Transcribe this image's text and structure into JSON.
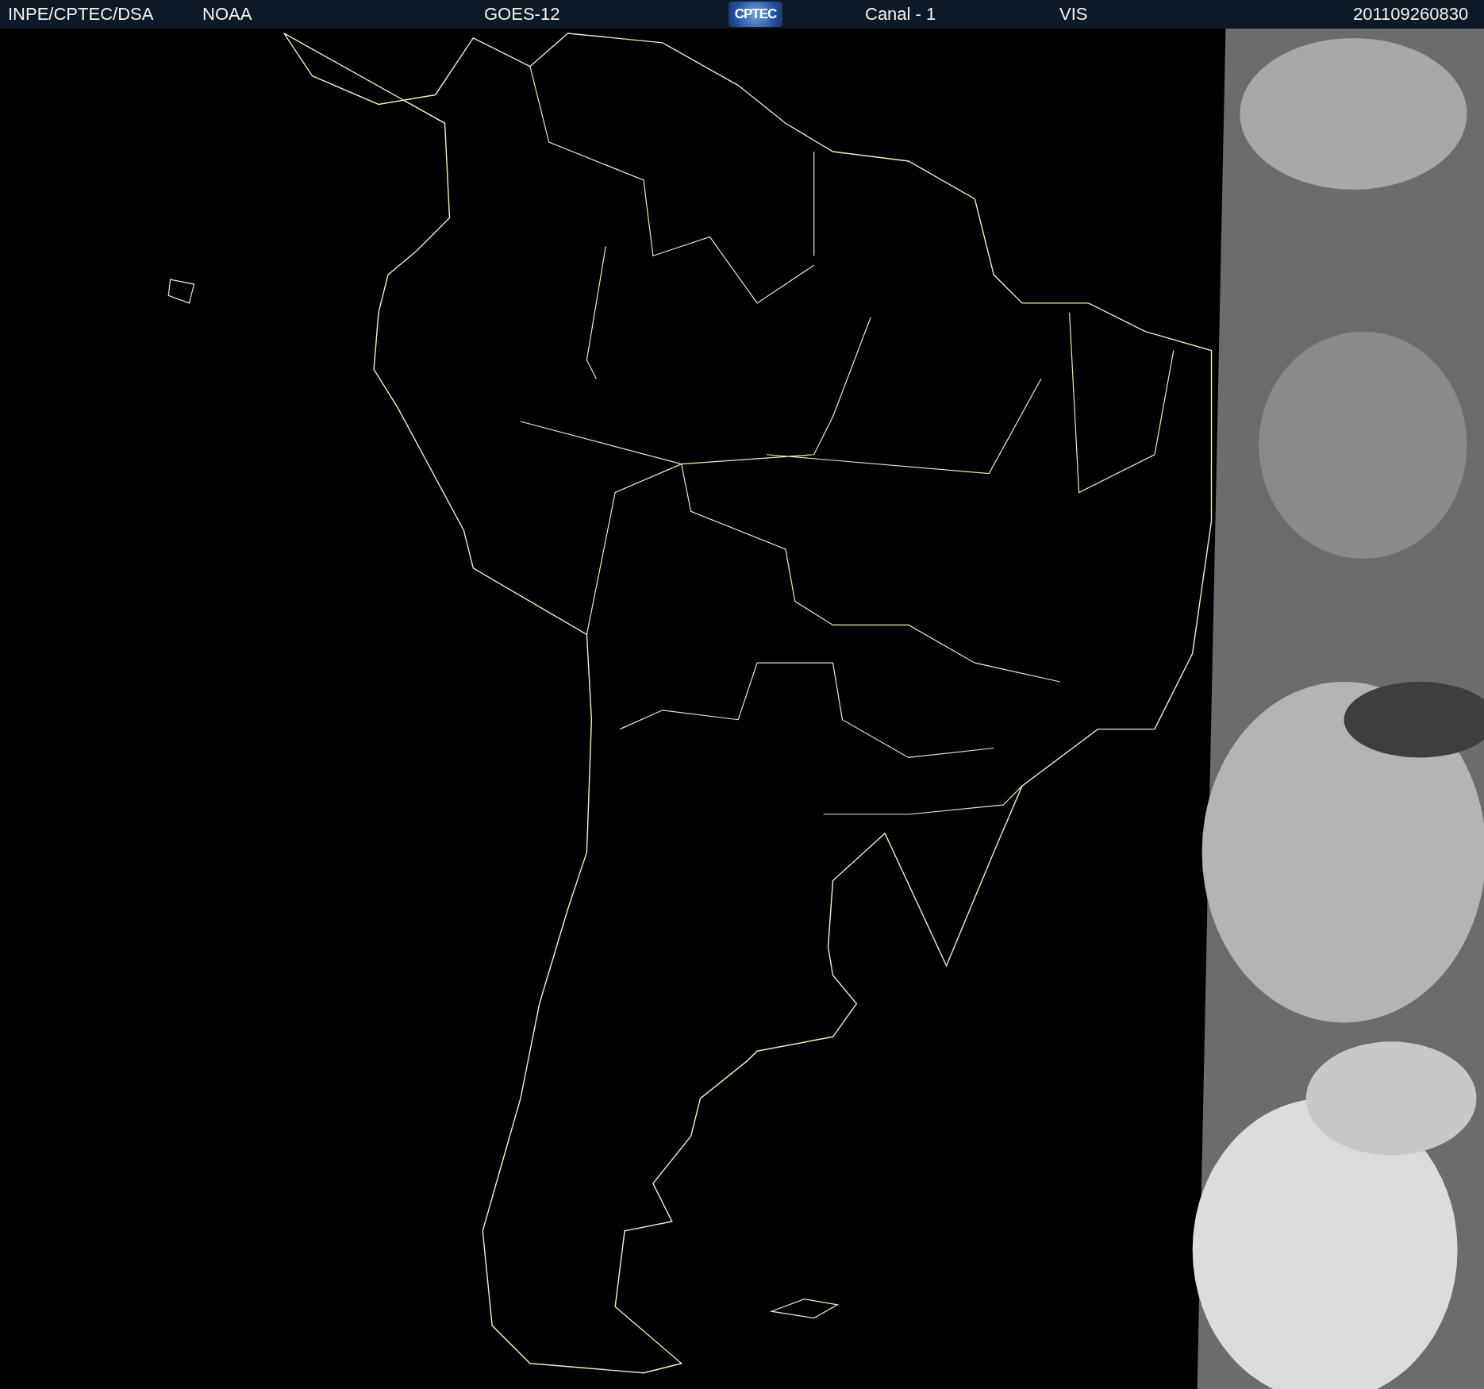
{
  "header": {
    "items": [
      {
        "kind": "text",
        "text": "INPE/CPTEC/DSA"
      },
      {
        "kind": "text",
        "text": "NOAA"
      },
      {
        "kind": "text",
        "text": "GOES-12"
      },
      {
        "kind": "logo",
        "text": "CPTEC"
      },
      {
        "kind": "text",
        "text": "Canal - 1"
      },
      {
        "kind": "text",
        "text": "VIS"
      },
      {
        "kind": "text",
        "text": "201109260830"
      }
    ]
  }
}
